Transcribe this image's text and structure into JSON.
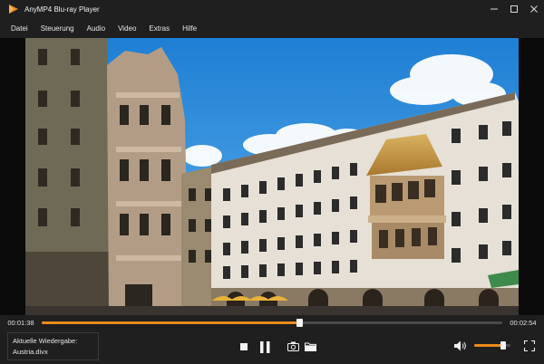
{
  "window": {
    "title": "AnyMP4 Blu-ray Player",
    "accent_color": "#f08a1d"
  },
  "menu": {
    "items": [
      {
        "label": "Datei"
      },
      {
        "label": "Steuerung"
      },
      {
        "label": "Audio"
      },
      {
        "label": "Video"
      },
      {
        "label": "Extras"
      },
      {
        "label": "Hilfe"
      }
    ]
  },
  "playback": {
    "elapsed": "00:01:38",
    "total": "00:02:54",
    "progress_fraction": 0.56,
    "volume_fraction": 0.8
  },
  "now_playing": {
    "label": "Aktuelle Wiedergabe:",
    "file": "Austria.divx"
  },
  "icons": {
    "minimize": "minimize-icon",
    "maximize": "maximize-icon",
    "close": "close-icon",
    "stop": "stop-icon",
    "pause": "pause-icon",
    "snapshot": "camera-icon",
    "folder": "folder-icon",
    "volume": "speaker-icon",
    "fullscreen": "fullscreen-icon"
  }
}
